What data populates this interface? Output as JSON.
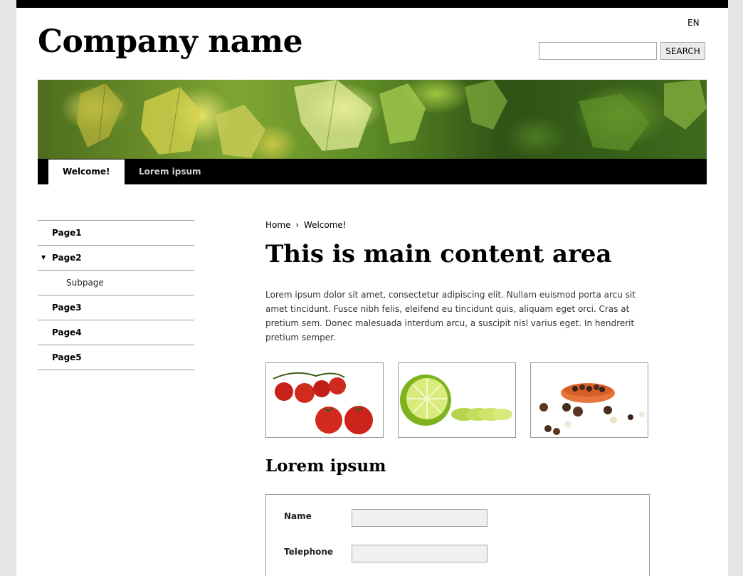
{
  "header": {
    "language": "EN",
    "logo": "Company name",
    "search": {
      "placeholder": "",
      "button_label": "SEARCH"
    }
  },
  "nav": {
    "tabs": [
      {
        "label": "Welcome!",
        "active": true
      },
      {
        "label": "Lorem ipsum",
        "active": false
      }
    ]
  },
  "sidebar": {
    "items": [
      {
        "label": "Page1"
      },
      {
        "label": "Page2",
        "expanded": true
      },
      {
        "label": "Subpage"
      },
      {
        "label": "Page3"
      },
      {
        "label": "Page4"
      },
      {
        "label": "Page5"
      }
    ]
  },
  "breadcrumb": {
    "home": "Home",
    "separator": "›",
    "current": "Welcome!"
  },
  "main": {
    "title": "This is main content area",
    "intro": "Lorem ipsum dolor sit amet, consectetur adipiscing elit. Nullam euismod porta arcu sit amet tincidunt. Fusce nibh felis, eleifend eu tincidunt quis, aliquam eget orci. Cras at pretium sem. Donec malesuada interdum arcu, a suscipit nisl varius eget. In hendrerit pretium semper.",
    "thumbnails": [
      "tomatoes-image",
      "lime-image",
      "peppercorns-image"
    ],
    "section_title": "Lorem ipsum"
  },
  "form": {
    "name_label": "Name",
    "telephone_label": "Telephone"
  }
}
